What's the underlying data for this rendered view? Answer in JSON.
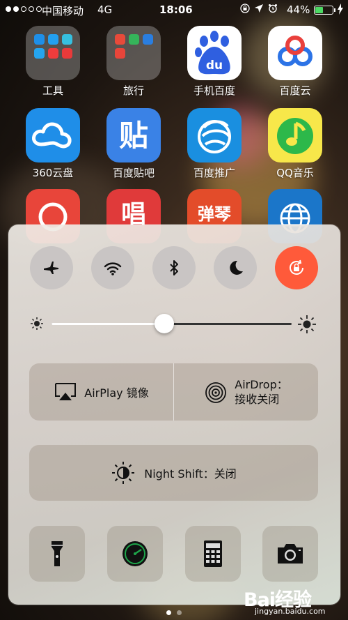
{
  "status_bar": {
    "carrier": "中国移动",
    "network": "4G",
    "time": "18:06",
    "battery_percent": "44%",
    "battery_level": 0.44
  },
  "apps": [
    {
      "name": "工具",
      "type": "folder"
    },
    {
      "name": "旅行",
      "type": "folder"
    },
    {
      "name": "手机百度",
      "type": "app",
      "color": "#ffffff"
    },
    {
      "name": "百度云",
      "type": "app",
      "color": "#ffffff"
    },
    {
      "name": "360云盘",
      "type": "app",
      "color": "#1f8ee8"
    },
    {
      "name": "百度贴吧",
      "type": "app",
      "color": "#3a82e6",
      "glyph": "贴"
    },
    {
      "name": "百度推广",
      "type": "app",
      "color": "#1a8fe0"
    },
    {
      "name": "QQ音乐",
      "type": "app",
      "color": "#f7e74a"
    }
  ],
  "partial_apps": [
    {
      "color": "#e8453a"
    },
    {
      "color": "#e03a3a",
      "glyph": "唱"
    },
    {
      "color": "#e34c2a",
      "glyph": "弹琴"
    },
    {
      "color": "#1b76c9"
    }
  ],
  "control_center": {
    "toggles": [
      {
        "id": "airplane",
        "active": false
      },
      {
        "id": "wifi",
        "active": false
      },
      {
        "id": "bluetooth",
        "active": false
      },
      {
        "id": "do-not-disturb",
        "active": false
      },
      {
        "id": "rotation-lock",
        "active": true
      }
    ],
    "brightness_level": 0.47,
    "airplay_label": "AirPlay 镜像",
    "airdrop_label_line1": "AirDrop：",
    "airdrop_label_line2": "接收关闭",
    "night_shift_label": "Night Shift：关闭",
    "bottom_buttons": [
      "flashlight-icon",
      "timer-icon",
      "calculator-icon",
      "camera-icon"
    ]
  },
  "page_indicator": {
    "count": 2,
    "current": 1
  },
  "watermark": {
    "logo": "Bai经验",
    "url": "jingyan.baidu.com"
  },
  "colors": {
    "active_toggle": "#ff5a3a",
    "battery_fill": "#4cd964"
  }
}
